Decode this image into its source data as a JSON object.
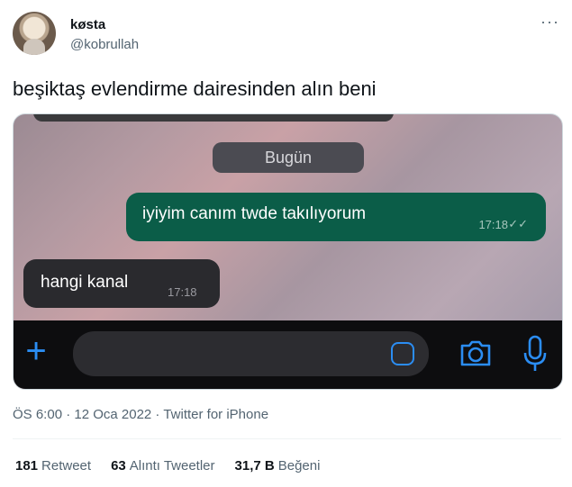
{
  "author": {
    "name": "køsta",
    "handle": "@kobrullah"
  },
  "more_icon": "ellipsis-icon",
  "tweet": {
    "text": "beşiktaş evlendirme dairesinden alın beni"
  },
  "chat": {
    "date_label": "Bugün",
    "outgoing": {
      "text": "iyiyim canım twde takılıyorum",
      "time": "17:18",
      "status_icon": "double-check-icon"
    },
    "incoming": {
      "text": "hangi kanal",
      "time": "17:18"
    },
    "input_bar": {
      "plus_icon": "plus-icon",
      "sticker_icon": "sticker-icon",
      "camera_icon": "camera-icon",
      "mic_icon": "microphone-icon",
      "accent": "#2b8df3"
    }
  },
  "meta": {
    "timestamp": "ÖS 6:00 · 12 Oca 2022 · Twitter for iPhone"
  },
  "stats": [
    {
      "count": "181",
      "label": "Retweet"
    },
    {
      "count": "63",
      "label": "Alıntı Tweetler"
    },
    {
      "count": "31,7 B",
      "label": "Beğeni"
    }
  ]
}
